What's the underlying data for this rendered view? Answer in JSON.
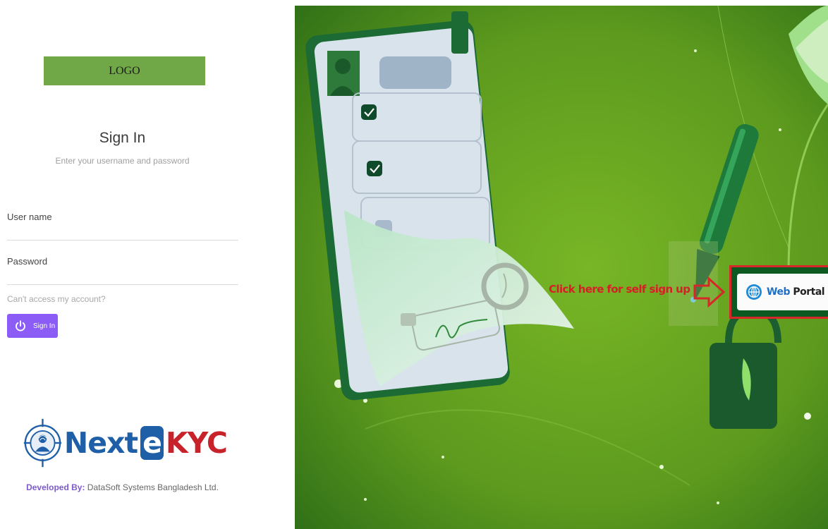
{
  "logo": {
    "text": "LOGO"
  },
  "signin": {
    "title": "Sign In",
    "subtitle": "Enter your username and password",
    "username_label": "User name",
    "username_value": "",
    "password_label": "Password",
    "password_value": "",
    "cant_access": "Can't access my account?",
    "button_label": "Sign In",
    "button_icon": "power-icon"
  },
  "brand": {
    "name_part1": "Next",
    "name_part2": "e",
    "name_part3": "KYC",
    "icon": "fingerprint-user-icon",
    "developed_by_label": "Developed By:",
    "developer": "DataSoft Systems Bangladesh Ltd."
  },
  "hero": {
    "cta_text": "Click here for self sign up",
    "portal_word1": "Web",
    "portal_word2": "Portal",
    "portal_icon": "globe-icon"
  },
  "colors": {
    "accent_purple": "#8b5cf6",
    "logo_green": "#70a847",
    "hero_green": "#5d9a1e",
    "highlight_red": "#d62828",
    "brand_blue": "#1f5fa8",
    "brand_red": "#c8222b"
  }
}
